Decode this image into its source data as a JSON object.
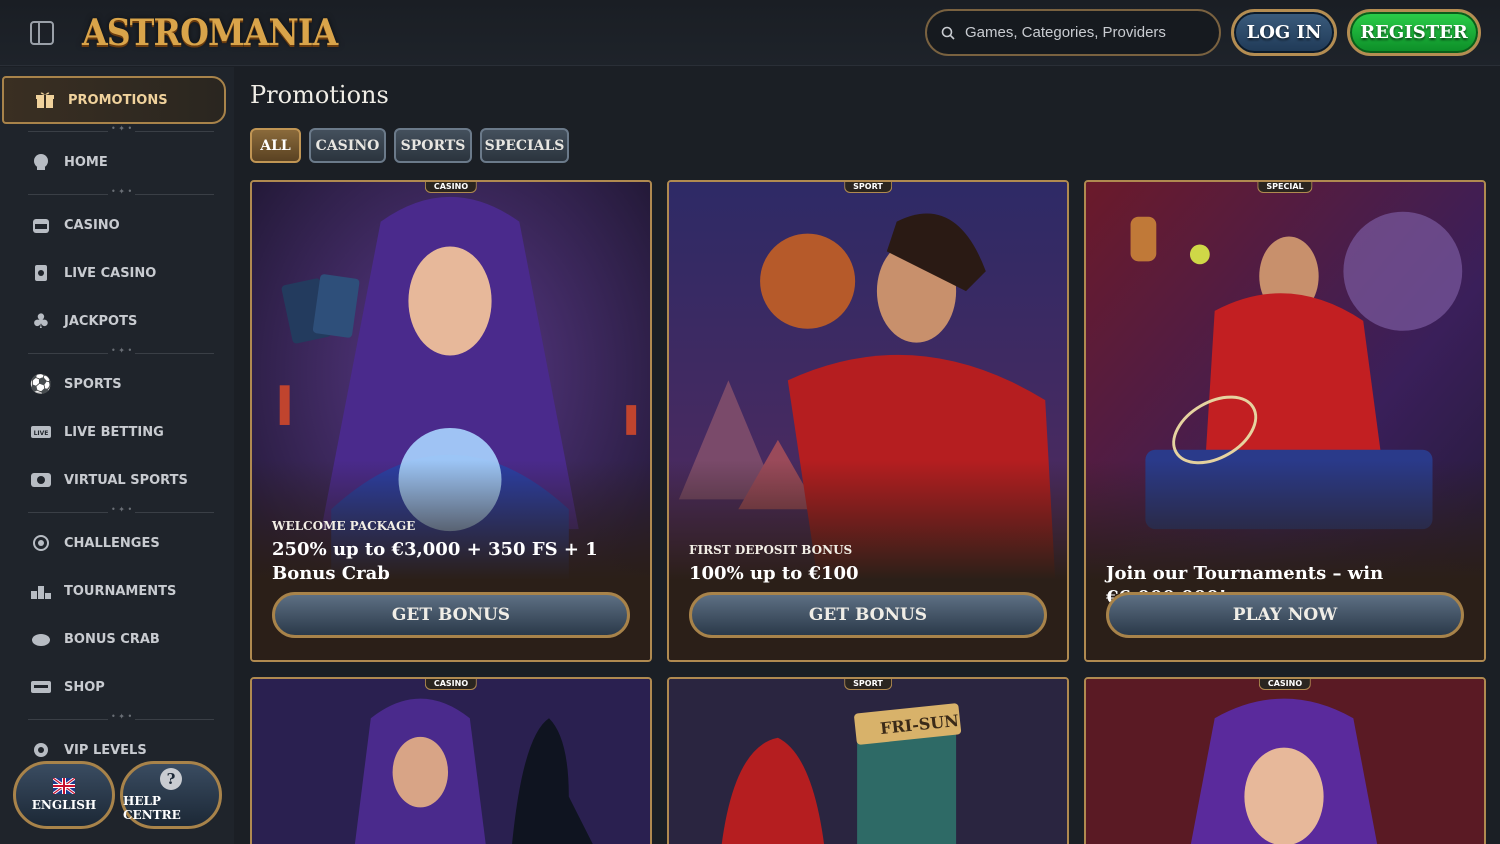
{
  "brand": {
    "logo_text": "ASTROMANIA"
  },
  "header": {
    "search_placeholder": "Games, Categories, Providers",
    "login_label": "LOG IN",
    "register_label": "REGISTER"
  },
  "sidebar": {
    "items": [
      {
        "label": "PROMOTIONS",
        "icon": "gift-icon"
      },
      {
        "label": "HOME",
        "icon": "home-icon"
      },
      {
        "label": "CASINO",
        "icon": "slot-machine-icon"
      },
      {
        "label": "LIVE CASINO",
        "icon": "live-card-icon"
      },
      {
        "label": "JACKPOTS",
        "icon": "clover-icon"
      },
      {
        "label": "SPORTS",
        "icon": "soccer-ball-icon"
      },
      {
        "label": "LIVE BETTING",
        "icon": "live-badge-icon"
      },
      {
        "label": "VIRTUAL SPORTS",
        "icon": "virtual-ball-icon"
      },
      {
        "label": "CHALLENGES",
        "icon": "target-icon"
      },
      {
        "label": "TOURNAMENTS",
        "icon": "podium-icon"
      },
      {
        "label": "BONUS CRAB",
        "icon": "crab-icon"
      },
      {
        "label": "SHOP",
        "icon": "shop-icon"
      },
      {
        "label": "VIP LEVELS",
        "icon": "vip-icon"
      }
    ],
    "language_label": "ENGLISH",
    "help_label": "HELP CENTRE"
  },
  "main": {
    "title": "Promotions",
    "filters": [
      "ALL",
      "CASINO",
      "SPORTS",
      "SPECIALS"
    ],
    "cards": [
      {
        "tag": "CASINO",
        "eyebrow": "WELCOME PACKAGE",
        "headline": "250% up to €3,000 + 350 FS + 1 Bonus Crab",
        "cta": "GET BONUS"
      },
      {
        "tag": "SPORT",
        "eyebrow": "FIRST DEPOSIT BONUS",
        "headline": "100% up to €100",
        "cta": "GET BONUS"
      },
      {
        "tag": "SPECIAL",
        "eyebrow": "",
        "headline": "Join our Tournaments – win €6,000,000!",
        "cta": "PLAY NOW"
      },
      {
        "tag": "CASINO",
        "eyebrow": "",
        "headline": "",
        "cta": ""
      },
      {
        "tag": "SPORT",
        "eyebrow": "",
        "headline": "",
        "cta": ""
      },
      {
        "tag": "CASINO",
        "eyebrow": "",
        "headline": "",
        "cta": ""
      }
    ],
    "booth_sign": "FRI-SUN"
  },
  "colors": {
    "gold": "#b08a50",
    "register_green": "#18b038",
    "login_blue": "#2c4a6a",
    "background": "#1b1f25"
  }
}
